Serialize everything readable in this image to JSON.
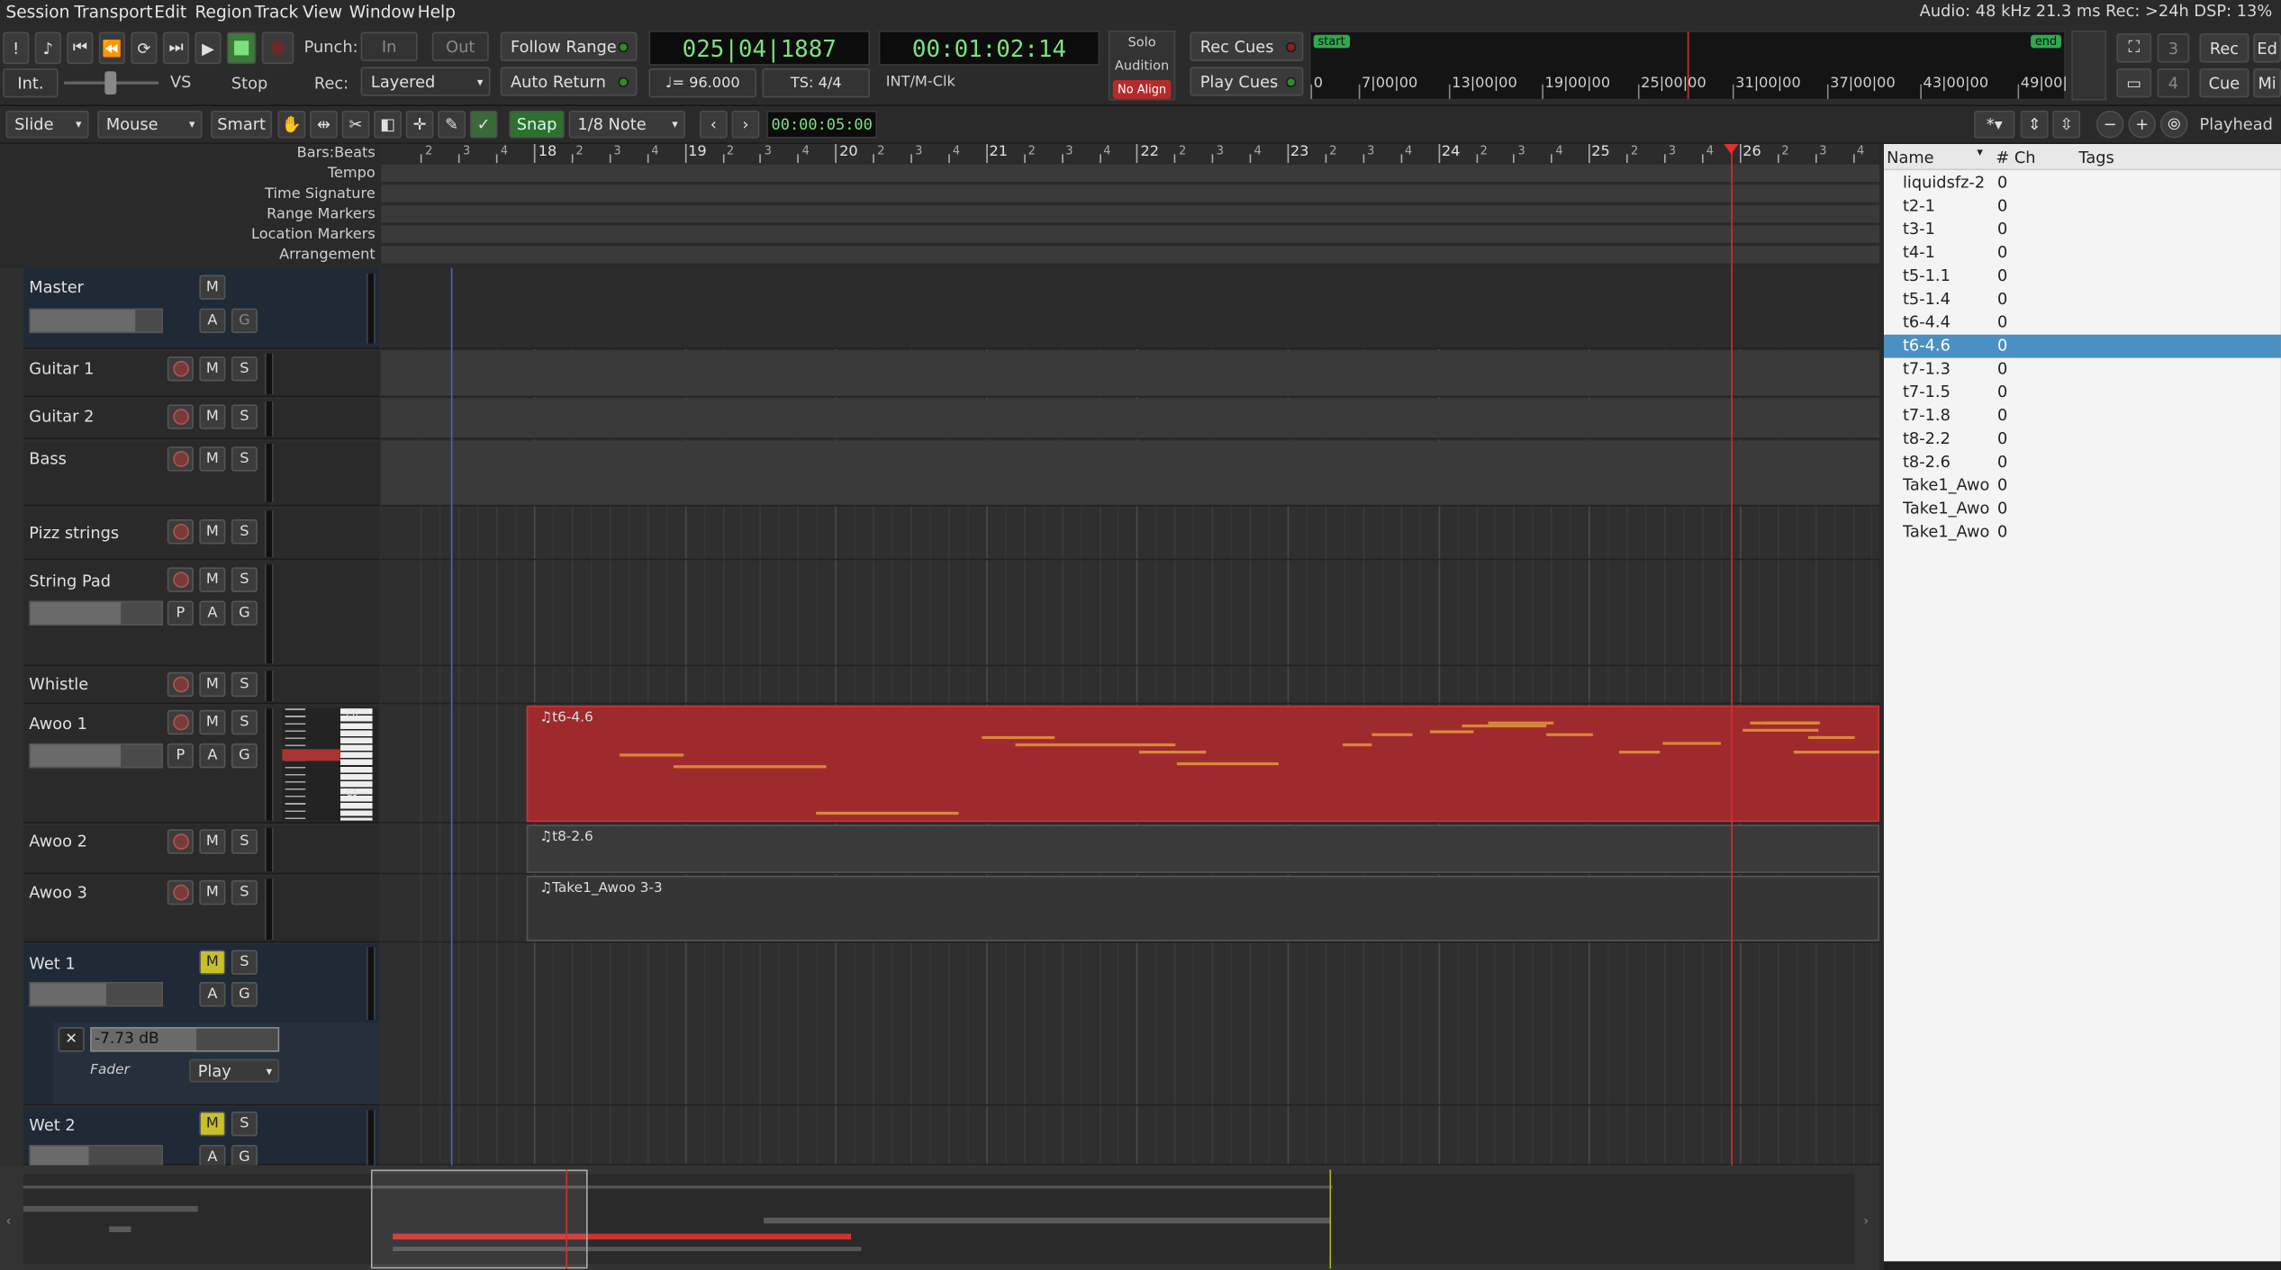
{
  "menu": [
    "Session",
    "Transport",
    "Edit",
    "Region",
    "Track",
    "View",
    "Window",
    "Help"
  ],
  "status": "Audio: 48 kHz 21.3 ms  Rec: >24h  DSP: 13%",
  "transport": {
    "int": "Int.",
    "vs": "VS",
    "stop": "Stop",
    "punch": "Punch:",
    "in": "In",
    "out": "Out",
    "rec": "Rec:",
    "rec_mode": "Layered",
    "follow_range": "Follow Range",
    "auto_return": "Auto Return",
    "bbt": "025|04|1887",
    "timecode": "00:01:02:14",
    "tempo": "♩= 96.000",
    "ts": "TS: 4/4",
    "sync": "INT/M-Clk",
    "solo": "Solo",
    "audition": "Audition",
    "no_align": "No Align",
    "rec_cues": "Rec Cues",
    "play_cues": "Play Cues",
    "mini_start": "start",
    "mini_end": "end",
    "mini_ticks": [
      "0",
      "7|00|00",
      "13|00|00",
      "19|00|00",
      "25|00|00",
      "31|00|00",
      "37|00|00",
      "43|00|00",
      "49|00|"
    ],
    "right_btns": {
      "n3": "3",
      "n4": "4",
      "rec": "Rec",
      "cue": "Cue",
      "ed": "Ed",
      "mi": "Mi"
    }
  },
  "toolbar": {
    "edit_mode": "Slide",
    "mouse": "Mouse",
    "smart": "Smart",
    "snap": "Snap",
    "grid": "1/8 Note",
    "nudge": "00:00:05:00",
    "zoom_focus": "Playhead"
  },
  "rulers": [
    "Bars:Beats",
    "Tempo",
    "Time Signature",
    "Range Markers",
    "Location Markers",
    "Arrangement"
  ],
  "bars": [
    "18",
    "19",
    "20",
    "21",
    "22",
    "23",
    "24",
    "25",
    "26"
  ],
  "tracks": [
    {
      "name": "Master"
    },
    {
      "name": "Guitar 1"
    },
    {
      "name": "Guitar 2"
    },
    {
      "name": "Bass"
    },
    {
      "name": "Pizz strings"
    },
    {
      "name": "String Pad"
    },
    {
      "name": "Whistle"
    },
    {
      "name": "Awoo 1"
    },
    {
      "name": "Awoo 2"
    },
    {
      "name": "Awoo 3"
    },
    {
      "name": "Wet 1"
    },
    {
      "name": "Wet 2"
    }
  ],
  "btn": {
    "m": "M",
    "s": "S",
    "a": "A",
    "g": "G",
    "p": "P"
  },
  "regions": {
    "awoo1": "♫t6-4.6",
    "awoo2": "♫t8-2.6",
    "awoo3": "♫Take1_Awoo 3-3"
  },
  "piano": {
    "c6": "C6",
    "c5": "C5"
  },
  "fader_popup": {
    "value": "-7.73 dB",
    "label": "Fader",
    "mode": "Play"
  },
  "list": {
    "cols": [
      "Name",
      "# Ch",
      "Tags"
    ],
    "rows": [
      {
        "name": "liquidsfz-2",
        "ch": "0"
      },
      {
        "name": "t2-1",
        "ch": "0"
      },
      {
        "name": "t3-1",
        "ch": "0"
      },
      {
        "name": "t4-1",
        "ch": "0"
      },
      {
        "name": "t5-1.1",
        "ch": "0"
      },
      {
        "name": "t5-1.4",
        "ch": "0"
      },
      {
        "name": "t6-4.4",
        "ch": "0"
      },
      {
        "name": "t6-4.6",
        "ch": "0"
      },
      {
        "name": "t7-1.3",
        "ch": "0"
      },
      {
        "name": "t7-1.5",
        "ch": "0"
      },
      {
        "name": "t7-1.8",
        "ch": "0"
      },
      {
        "name": "t8-2.2",
        "ch": "0"
      },
      {
        "name": "t8-2.6",
        "ch": "0"
      },
      {
        "name": "Take1_Awoo",
        "ch": "0"
      },
      {
        "name": "Take1_Awoo",
        "ch": "0"
      },
      {
        "name": "Take1_Awoo",
        "ch": "0"
      }
    ],
    "selected": 7
  }
}
